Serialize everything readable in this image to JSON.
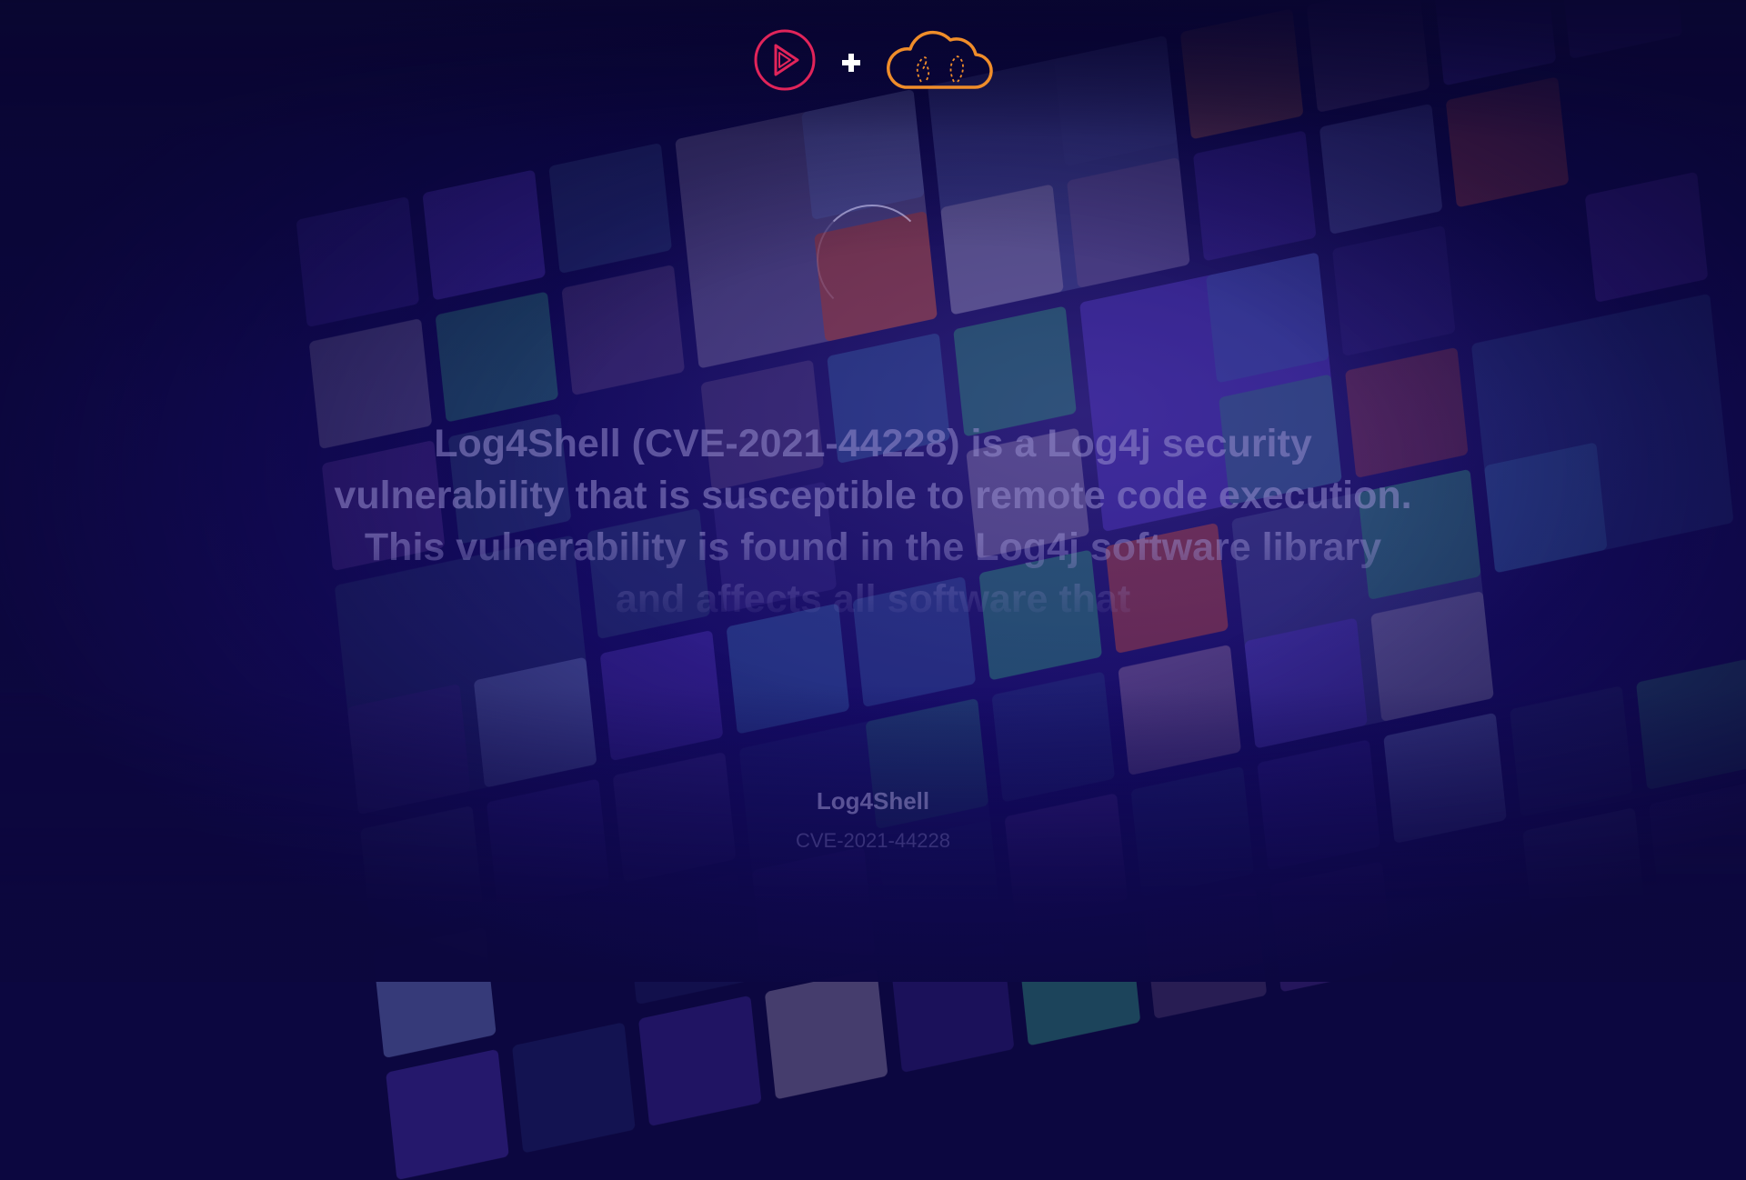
{
  "background": {
    "base_color": "#0c0740",
    "tile_colors": [
      "#3a2a8a",
      "#4b2fb0",
      "#5b3dd0",
      "#6a3ea8",
      "#2b3f7a",
      "#23307a",
      "#8a6a9a",
      "#b5a6c4",
      "#6a7ac0",
      "#c74a3a",
      "#e0763a",
      "#2f8f7a",
      "#7a3fd6",
      "#3a6ab0",
      "#4a4f96"
    ]
  },
  "logos": {
    "play_icon": "pluralsight-play-icon",
    "play_color": "#e1245a",
    "plus_icon": "plus-icon",
    "cloud_icon": "cloud-guru-cloud-icon",
    "cloud_color": "#f08d2a"
  },
  "loading": {
    "spinner_icon": "loading-spinner-icon"
  },
  "main": {
    "headline": "Log4Shell (CVE-2021-44228) is a Log4j security vulnerability that is susceptible to remote code execution. This vulnerability is found in the Log4j software library and affects all software that"
  },
  "caption": {
    "title": "Log4Shell",
    "subtitle": "CVE-2021-44228"
  }
}
